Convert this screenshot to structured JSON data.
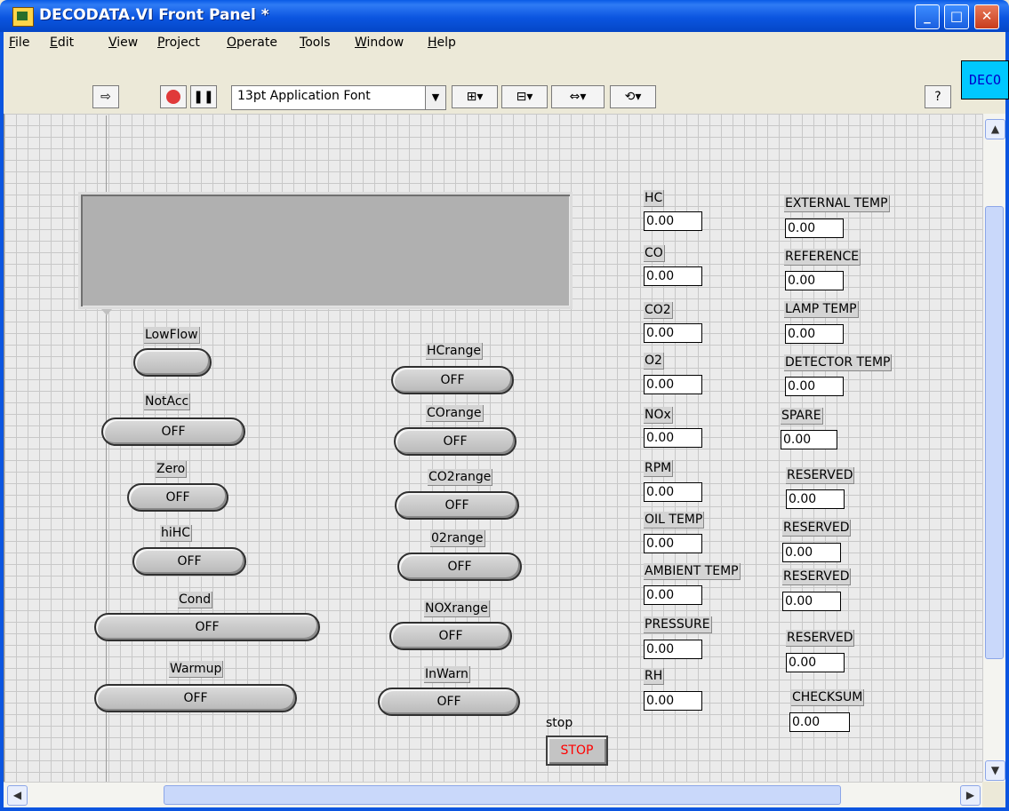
{
  "window": {
    "title": "DECODATA.VI Front Panel *",
    "minimize": "_",
    "maximize": "□",
    "close": "✕"
  },
  "menu": [
    "File",
    "Edit",
    "View",
    "Project",
    "Operate",
    "Tools",
    "Window",
    "Help"
  ],
  "toolbar": {
    "font": "13pt Application Font",
    "vi_icon_text": "DECO",
    "help": "?"
  },
  "booleans_left": [
    {
      "label": "LowFlow",
      "value": ""
    },
    {
      "label": "NotAcc",
      "value": "OFF"
    },
    {
      "label": "Zero",
      "value": "OFF"
    },
    {
      "label": "hiHC",
      "value": "OFF"
    },
    {
      "label": "Cond",
      "value": "OFF"
    },
    {
      "label": "Warmup",
      "value": "OFF"
    }
  ],
  "booleans_mid": [
    {
      "label": "HCrange",
      "value": "OFF"
    },
    {
      "label": "COrange",
      "value": "OFF"
    },
    {
      "label": "CO2range",
      "value": "OFF"
    },
    {
      "label": "02range",
      "value": "OFF"
    },
    {
      "label": "NOXrange",
      "value": "OFF"
    },
    {
      "label": "InWarn",
      "value": "OFF"
    }
  ],
  "numerics_col1": [
    {
      "label": "HC",
      "value": "0.00"
    },
    {
      "label": "CO",
      "value": "0.00"
    },
    {
      "label": "CO2",
      "value": "0.00"
    },
    {
      "label": "O2",
      "value": "0.00"
    },
    {
      "label": "NOx",
      "value": "0.00"
    },
    {
      "label": "RPM",
      "value": "0.00"
    },
    {
      "label": "OIL TEMP",
      "value": "0.00"
    },
    {
      "label": "AMBIENT TEMP",
      "value": "0.00"
    },
    {
      "label": "PRESSURE",
      "value": "0.00"
    },
    {
      "label": "RH",
      "value": "0.00"
    }
  ],
  "numerics_col2": [
    {
      "label": "EXTERNAL TEMP",
      "value": "0.00"
    },
    {
      "label": "REFERENCE",
      "value": "0.00"
    },
    {
      "label": "LAMP TEMP",
      "value": "0.00"
    },
    {
      "label": "DETECTOR TEMP",
      "value": "0.00"
    },
    {
      "label": "SPARE",
      "value": "0.00"
    },
    {
      "label": "RESERVED",
      "value": "0.00"
    },
    {
      "label": "RESERVED",
      "value": "0.00"
    },
    {
      "label": "RESERVED",
      "value": "0.00"
    },
    {
      "label": "RESERVED",
      "value": "0.00"
    },
    {
      "label": "CHECKSUM",
      "value": "0.00"
    }
  ],
  "stop": {
    "label": "stop",
    "button": "STOP"
  }
}
